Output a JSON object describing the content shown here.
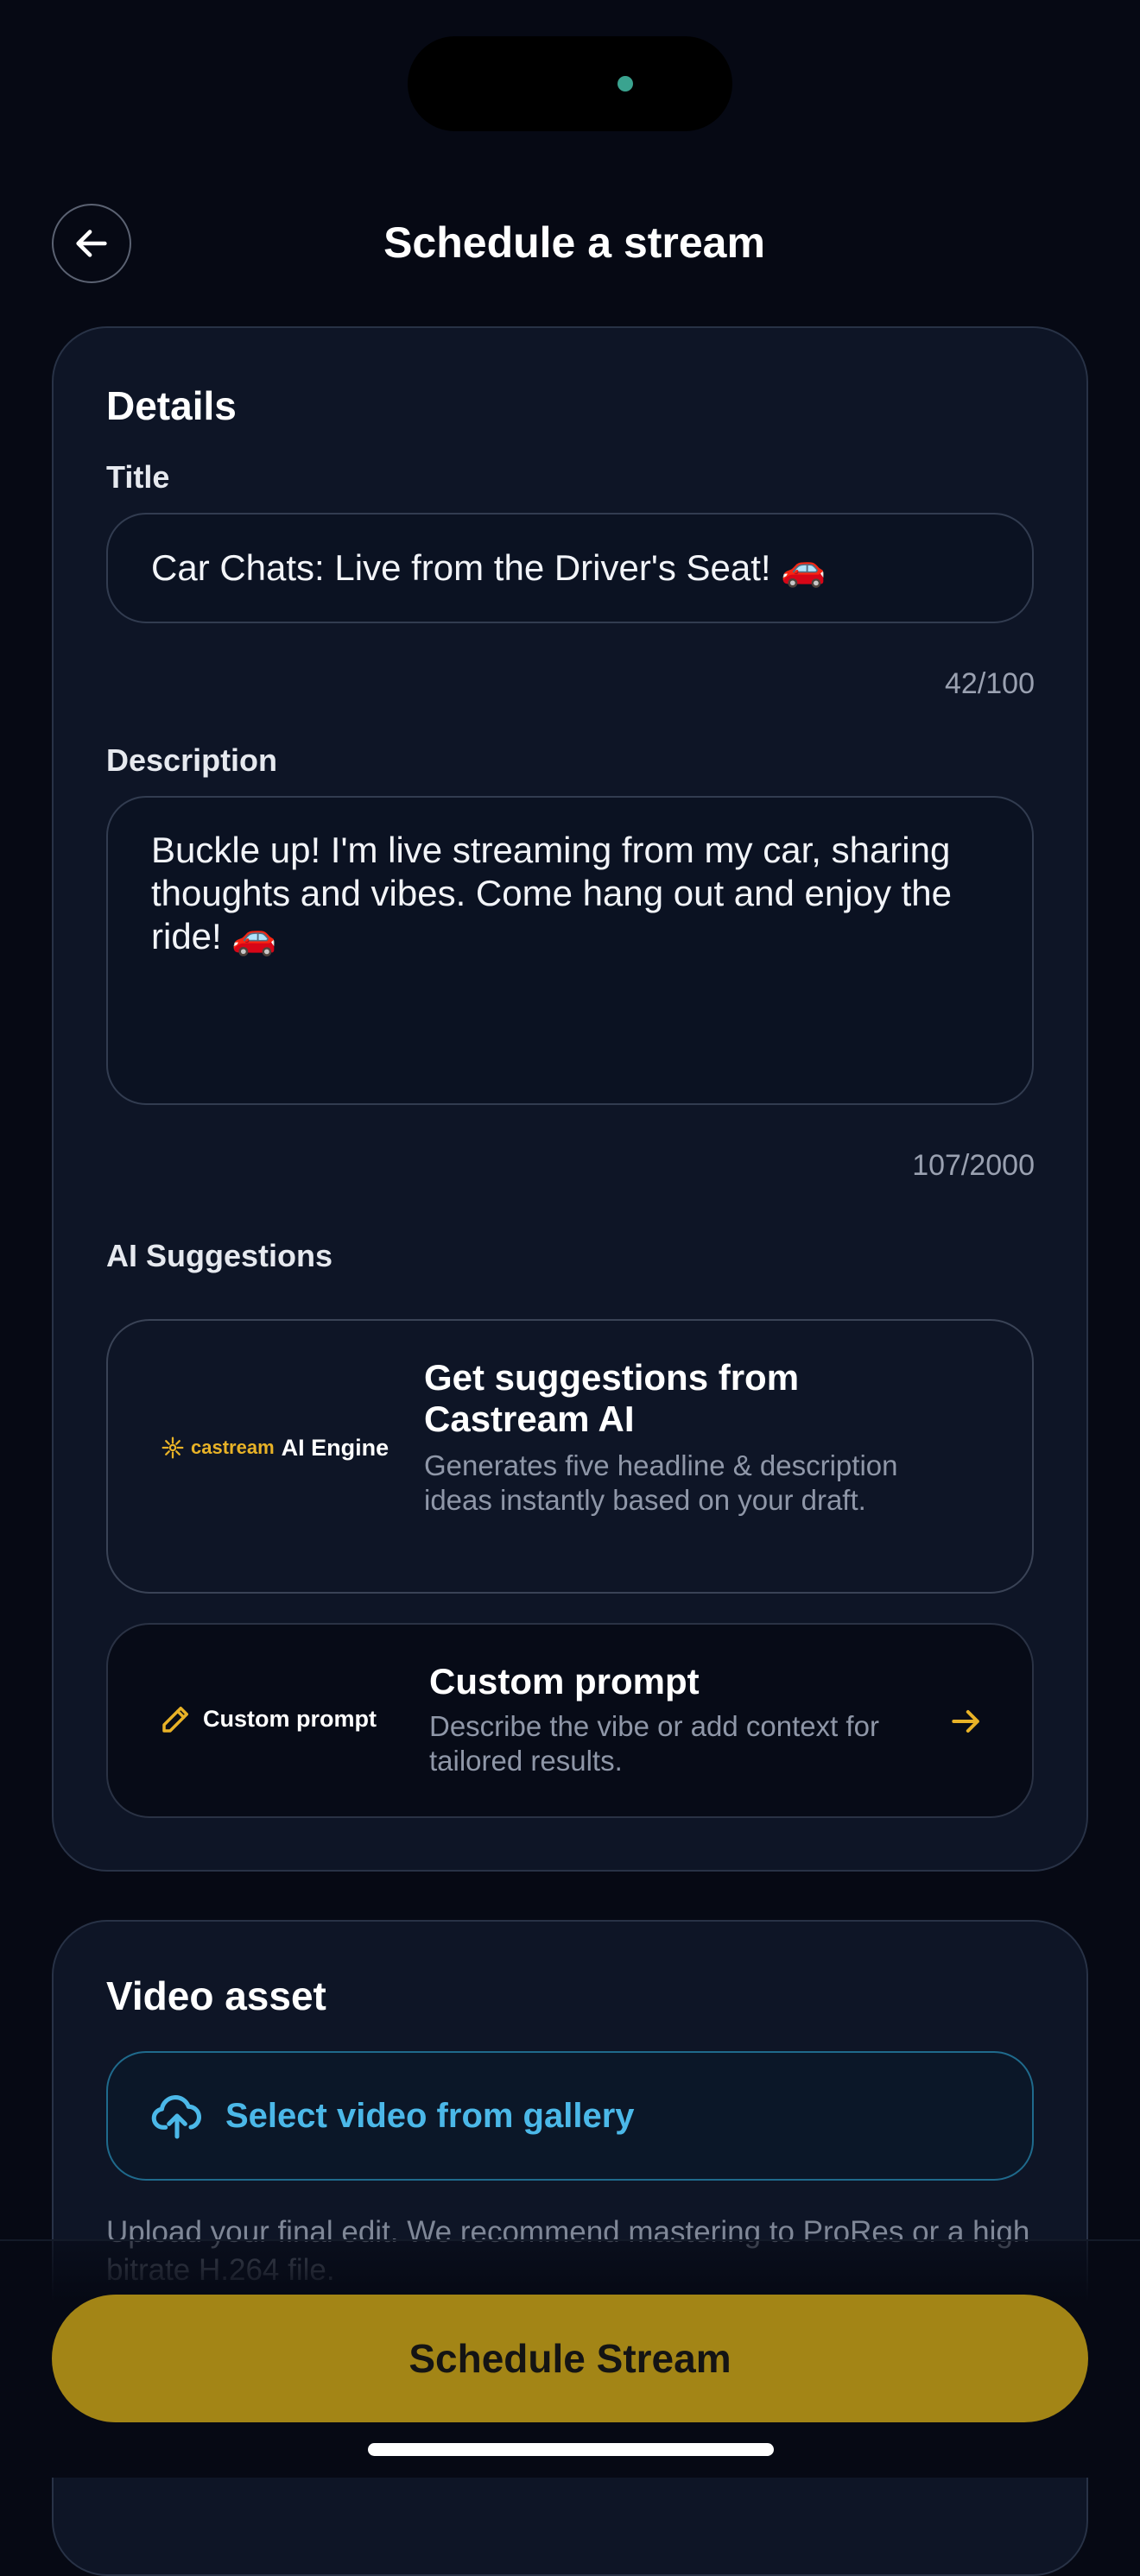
{
  "header": {
    "title": "Schedule a stream"
  },
  "details": {
    "heading": "Details",
    "title_label": "Title",
    "title_value": "Car Chats: Live from the Driver's Seat! 🚗",
    "title_counter": "42/100",
    "description_label": "Description",
    "description_value": "Buckle up! I'm live streaming from my car, sharing thoughts and vibes. Come hang out and enjoy the ride! 🚗",
    "description_counter": "107/2000"
  },
  "ai_suggestions": {
    "heading": "AI Suggestions",
    "engine_card": {
      "brand": "castream",
      "badge": "AI Engine",
      "title": "Get suggestions from Castream AI",
      "description": "Generates five headline & description ideas instantly based on your draft."
    },
    "custom_card": {
      "badge": "Custom prompt",
      "title": "Custom prompt",
      "description": "Describe the vibe or add context for tailored results."
    }
  },
  "video_asset": {
    "heading": "Video asset",
    "select_label": "Select video from gallery",
    "hint": "Upload your final edit. We recommend mastering to ProRes or a high bitrate H.264 file."
  },
  "cta": {
    "label": "Schedule Stream"
  },
  "colors": {
    "background": "#060914",
    "card": "#0e1526",
    "accent_gold": "#a38516",
    "accent_blue": "#4bb8e8",
    "icon_gold": "#e8b227"
  }
}
